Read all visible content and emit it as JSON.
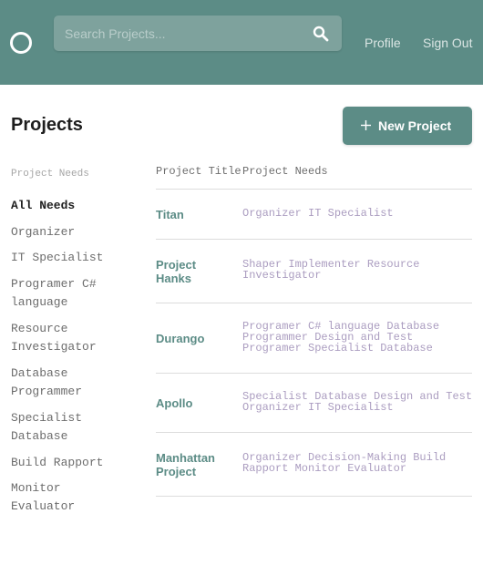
{
  "header": {
    "search_placeholder": "Search Projects...",
    "nav": {
      "profile": "Profile",
      "sign_out": "Sign Out"
    }
  },
  "page": {
    "title": "Projects",
    "new_project_label": "New Project"
  },
  "sidebar": {
    "heading": "Project Needs",
    "filters": [
      "All Needs",
      "Organizer",
      "IT Specialist",
      "Programer C# language",
      "Resource Investigator",
      "Database Programmer",
      "Specialist Database",
      "Build Rapport",
      "Monitor Evaluator"
    ]
  },
  "table": {
    "headers": {
      "title": "Project Title",
      "needs": "Project Needs"
    },
    "rows": [
      {
        "title": "Titan",
        "needs": "Organizer IT Specialist"
      },
      {
        "title": "Project Hanks",
        "needs": "Shaper Implementer Resource Investigator"
      },
      {
        "title": "Durango",
        "needs": "Programer C# language Database Programmer Design and Test Programer Specialist Database"
      },
      {
        "title": "Apollo",
        "needs": "Specialist Database Design and Test Organizer IT Specialist"
      },
      {
        "title": "Manhattan Project",
        "needs": "Organizer Decision-Making Build Rapport Monitor Evaluator"
      }
    ]
  },
  "colors": {
    "brand": "#5c8c86",
    "needs_text": "#ab9dc0"
  }
}
